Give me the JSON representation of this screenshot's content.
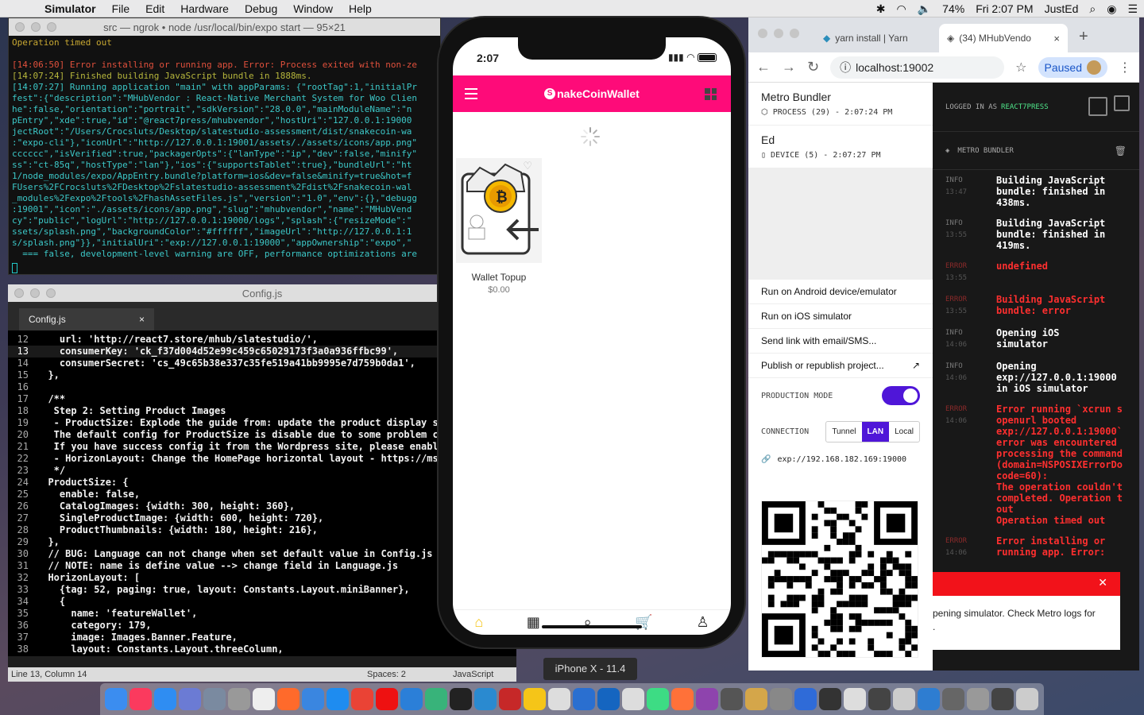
{
  "menubar": {
    "apple": "",
    "app_name": "Simulator",
    "items": [
      "File",
      "Edit",
      "Hardware",
      "Debug",
      "Window",
      "Help"
    ],
    "battery": "74%",
    "clock": "Fri 2:07 PM",
    "user": "JustEd"
  },
  "terminal": {
    "title": "src — ngrok • node /usr/local/bin/expo start — 95×21",
    "lines": [
      {
        "cls": "",
        "text": "Operation timed out"
      },
      {
        "cls": "",
        "text": " "
      },
      {
        "cls": "tline-err",
        "text": "[14:06:50] Error installing or running app. Error: Process exited with non-ze"
      },
      {
        "cls": "tline-ok",
        "text": "[14:07:24] Finished building JavaScript bundle in 1888ms."
      },
      {
        "cls": "tline-run",
        "text": "[14:07:27] Running application \"main\" with appParams: {\"rootTag\":1,\"initialPr"
      },
      {
        "cls": "tline-run",
        "text": "fest\":{\"description\":\"MHubVendor : React-Native Merchant System for Woo Clien"
      },
      {
        "cls": "tline-run",
        "text": "he\":false,\"orientation\":\"portrait\",\"sdkVersion\":\"28.0.0\",\"mainModuleName\":\"n"
      },
      {
        "cls": "tline-run",
        "text": "pEntry\",\"xde\":true,\"id\":\"@react7press/mhubvendor\",\"hostUri\":\"127.0.0.1:19000"
      },
      {
        "cls": "tline-run",
        "text": "jectRoot\":\"/Users/Crocsluts/Desktop/slatestudio-assessment/dist/snakecoin-wa"
      },
      {
        "cls": "tline-run",
        "text": ":\"expo-cli\"},\"iconUrl\":\"http://127.0.0.1:19001/assets/./assets/icons/app.png\""
      },
      {
        "cls": "tline-run",
        "text": "cccccc\",\"isVerified\":true,\"packagerOpts\":{\"lanType\":\"ip\",\"dev\":false,\"minify\""
      },
      {
        "cls": "tline-run",
        "text": "ss\":\"ct-85q\",\"hostType\":\"lan\"},\"ios\":{\"supportsTablet\":true},\"bundleUrl\":\"ht"
      },
      {
        "cls": "tline-run",
        "text": "1/node_modules/expo/AppEntry.bundle?platform=ios&dev=false&minify=true&hot=f"
      },
      {
        "cls": "tline-run",
        "text": "FUsers%2FCrocsluts%2FDesktop%2Fslatestudio-assessment%2Fdist%2Fsnakecoin-wal"
      },
      {
        "cls": "tline-run",
        "text": "_modules%2Fexpo%2Ftools%2FhashAssetFiles.js\",\"version\":\"1.0\",\"env\":{},\"debugg"
      },
      {
        "cls": "tline-run",
        "text": ":19001\",\"icon\":\"./assets/icons/app.png\",\"slug\":\"mhubvendor\",\"name\":\"MHubVend"
      },
      {
        "cls": "tline-run",
        "text": "cy\":\"public\",\"logUrl\":\"http://127.0.0.1:19000/logs\",\"splash\":{\"resizeMode\":\""
      },
      {
        "cls": "tline-run",
        "text": "ssets/splash.png\",\"backgroundColor\":\"#ffffff\",\"imageUrl\":\"http://127.0.0.1:1"
      },
      {
        "cls": "tline-run",
        "text": "s/splash.png\"}},\"initialUri\":\"exp://127.0.0.1:19000\",\"appOwnership\":\"expo\",\""
      },
      {
        "cls": "tline-run",
        "text": "  === false, development-level warning are OFF, performance optimizations are"
      }
    ]
  },
  "editor": {
    "title": "Config.js",
    "tab": "Config.js",
    "lines": [
      {
        "n": "12",
        "t": "    url: 'http://react7.store/mhub/slatestudio/',"
      },
      {
        "n": "13",
        "t": "    consumerKey: 'ck_f37d004d52e99c459c65029173f3a0a936ffbc99',"
      },
      {
        "n": "14",
        "t": "    consumerSecret: 'cs_49c65b38e337c35fe519a41bb9995e7d759b0da1',"
      },
      {
        "n": "15",
        "t": "  },"
      },
      {
        "n": "16",
        "t": ""
      },
      {
        "n": "17",
        "t": "  /**"
      },
      {
        "n": "18",
        "t": "   Step 2: Setting Product Images"
      },
      {
        "n": "19",
        "t": "   - ProductSize: Explode the guide from: update the product display s"
      },
      {
        "n": "20",
        "t": "   The default config for ProductSize is disable due to some problem c"
      },
      {
        "n": "21",
        "t": "   If you have success config it from the Wordpress site, please enabl"
      },
      {
        "n": "22",
        "t": "   - HorizonLayout: Change the HomePage horizontal layout - https://ms"
      },
      {
        "n": "23",
        "t": "   */"
      },
      {
        "n": "24",
        "t": "  ProductSize: {"
      },
      {
        "n": "25",
        "t": "    enable: false,"
      },
      {
        "n": "26",
        "t": "    CatalogImages: {width: 300, height: 360},"
      },
      {
        "n": "27",
        "t": "    SingleProductImage: {width: 600, height: 720},"
      },
      {
        "n": "28",
        "t": "    ProductThumbnails: {width: 180, height: 216},"
      },
      {
        "n": "29",
        "t": "  },"
      },
      {
        "n": "30",
        "t": "  // BUG: Language can not change when set default value in Config.js"
      },
      {
        "n": "31",
        "t": "  // NOTE: name is define value --> change field in Language.js"
      },
      {
        "n": "32",
        "t": "  HorizonLayout: ["
      },
      {
        "n": "33",
        "t": "    {tag: 52, paging: true, layout: Constants.Layout.miniBanner},"
      },
      {
        "n": "34",
        "t": "    {"
      },
      {
        "n": "35",
        "t": "      name: 'featureWallet',"
      },
      {
        "n": "36",
        "t": "      category: 179,"
      },
      {
        "n": "37",
        "t": "      image: Images.Banner.Feature,"
      },
      {
        "n": "38",
        "t": "      layout: Constants.Layout.threeColumn,"
      },
      {
        "n": "39",
        "t": "    },"
      }
    ],
    "status_pos": "Line 13, Column 14",
    "status_spaces": "Spaces: 2",
    "status_lang": "JavaScript"
  },
  "phone": {
    "time": "2:07",
    "brand": "nakeCoinWallet",
    "brand_letter": "S",
    "product_name": "Wallet Topup",
    "product_price": "$0.00",
    "device_label": "iPhone X - 11.4"
  },
  "chrome": {
    "tab1": "yarn install | Yarn",
    "tab2": "(34) MHubVendo",
    "url": "localhost:19002",
    "paused": "Paused"
  },
  "expo": {
    "proc1_title": "Metro Bundler",
    "proc1_sub": "PROCESS (29) - 2:07:24 PM",
    "proc2_title": "Ed",
    "proc2_sub": "DEVICE (5) - 2:07:27 PM",
    "menu": [
      "Run on Android device/emulator",
      "Run on iOS simulator",
      "Send link with email/SMS...",
      "Publish or republish project..."
    ],
    "production_mode": "PRODUCTION MODE",
    "connection": "CONNECTION",
    "conn_options": [
      "Tunnel",
      "LAN",
      "Local"
    ],
    "exp_url": "exp://192.168.182.169:19000",
    "logged_in": "LOGGED IN AS",
    "logged_user": "REACT7PRESS",
    "panel_title": "METRO BUNDLER",
    "logs": [
      {
        "level": "INFO",
        "time": "13:47",
        "msg": "Building JavaScript\nbundle: finished in\n438ms.",
        "err": false
      },
      {
        "level": "INFO",
        "time": "13:55",
        "msg": "Building JavaScript\nbundle: finished in\n419ms.",
        "err": false
      },
      {
        "level": "ERROR",
        "time": "13:55",
        "msg": "undefined",
        "err": true
      },
      {
        "level": "ERROR",
        "time": "13:55",
        "msg": "Building JavaScript\nbundle: error",
        "err": true
      },
      {
        "level": "INFO",
        "time": "14:06",
        "msg": "Opening iOS\nsimulator",
        "err": false
      },
      {
        "level": "INFO",
        "time": "14:06",
        "msg": "Opening\nexp://127.0.0.1:19000\nin iOS simulator",
        "err": false
      },
      {
        "level": "ERROR",
        "time": "14:06",
        "msg": "Error running `xcrun s\nopenurl booted\nexp://127.0.0.1:19000`\nerror was encountered\nprocessing the command\n(domain=NSPOSIXErrorDo\ncode=60):\nThe operation couldn't\ncompleted. Operation t\nout\nOperation timed out",
        "err": true
      },
      {
        "level": "ERROR",
        "time": "14:06",
        "msg": "Error installing or\nrunning app. Error:",
        "err": true
      }
    ],
    "toast": "pening simulator. Check Metro logs for\n."
  }
}
